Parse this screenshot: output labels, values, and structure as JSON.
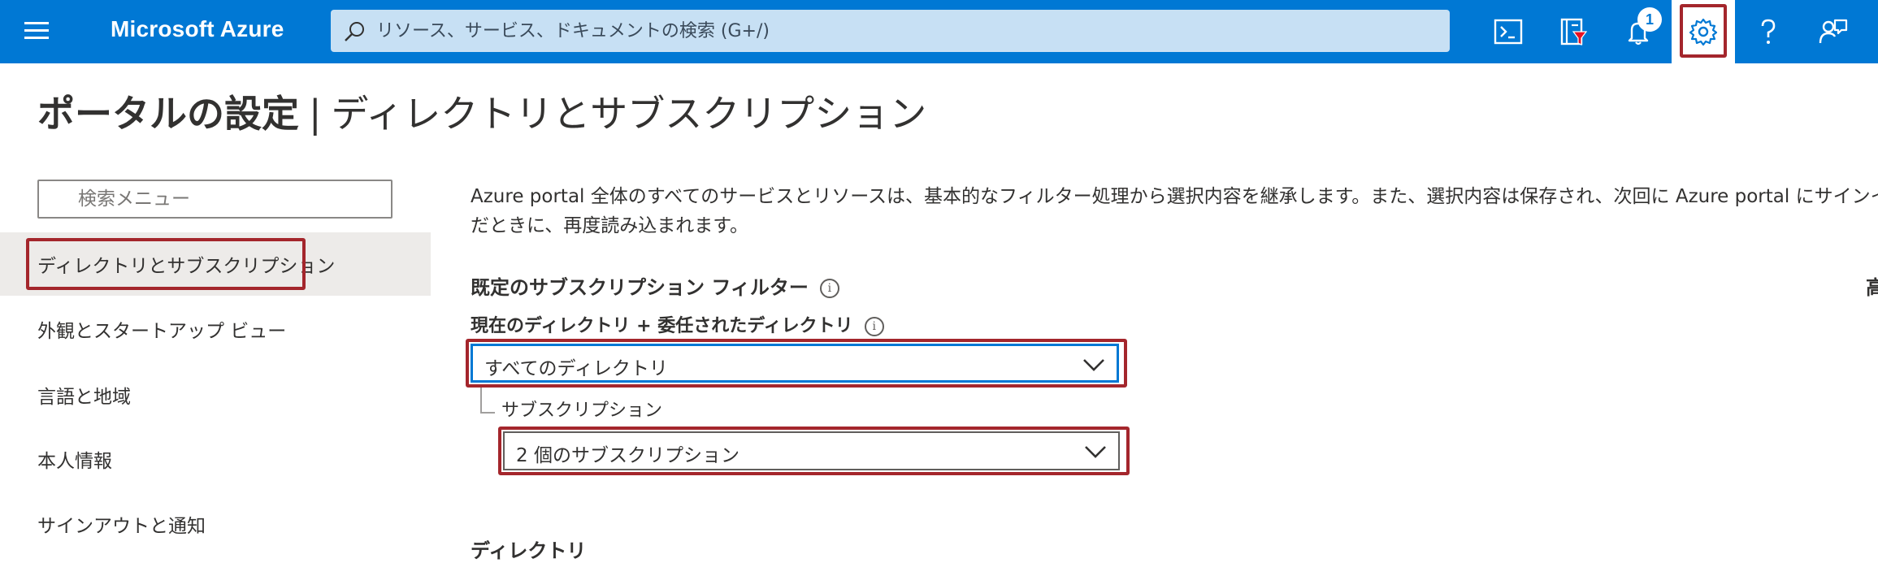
{
  "topbar": {
    "brand": "Microsoft Azure",
    "search_placeholder": "リソース、サービス、ドキュメントの検索 (G+/)",
    "notification_count": "1",
    "icons": [
      "cloud-shell-icon",
      "directory-filter-icon",
      "bell-icon",
      "gear-icon",
      "help-icon",
      "feedback-icon"
    ]
  },
  "page": {
    "title_main": "ポータルの設定",
    "title_sep": "|",
    "title_sub": "ディレクトリとサブスクリプション"
  },
  "sidebar": {
    "search_placeholder": "検索メニュー",
    "items": [
      {
        "label": "ディレクトリとサブスクリプション",
        "selected": true
      },
      {
        "label": "外観とスタートアップ ビュー",
        "selected": false
      },
      {
        "label": "言語と地域",
        "selected": false
      },
      {
        "label": "本人情報",
        "selected": false
      },
      {
        "label": "サインアウトと通知",
        "selected": false
      }
    ]
  },
  "main": {
    "description_line1": "Azure portal 全体のすべてのサービスとリソースは、基本的なフィルター処理から選択内容を継承します。また、選択内容は保存され、次回に Azure portal にサインインするた",
    "description_line2": "だときに、再度読み込まれます。",
    "section_title": "既定のサブスクリプション フィルター",
    "directory_label": "現在のディレクトリ + 委任されたディレクトリ",
    "directory_value": "すべてのディレクトリ",
    "subscription_label": "サブスクリプション",
    "subscription_value": "2 個のサブスクリプション",
    "right_edge_text": "高",
    "next_section_partial": "ディレクトリ"
  },
  "colors": {
    "topbar": "#0078d4",
    "highlight": "#a4262c",
    "selected_nav": "#edebe9"
  }
}
